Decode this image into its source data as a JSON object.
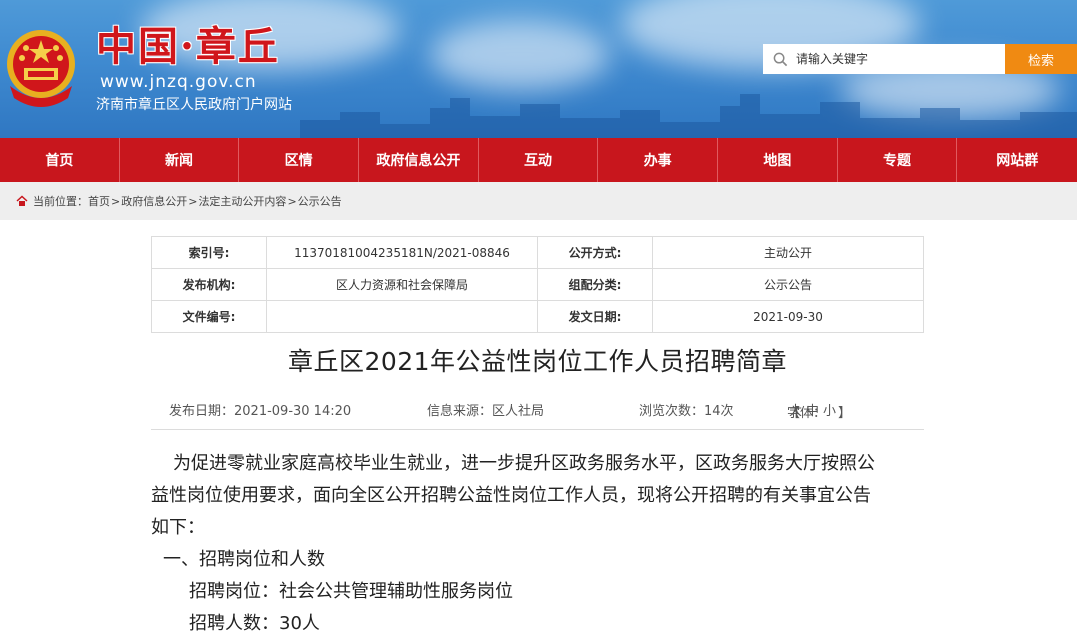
{
  "header": {
    "site_logo_text": "中国·章丘",
    "site_url": "www.jnzq.gov.cn",
    "site_subtitle": "济南市章丘区人民政府门户网站",
    "search_placeholder": "请输入关键字",
    "search_button": "检索"
  },
  "nav": {
    "items": [
      "首页",
      "新闻",
      "区情",
      "政府信息公开",
      "互动",
      "办事",
      "地图",
      "专题",
      "网站群"
    ]
  },
  "breadcrumb": {
    "prefix": "当前位置：",
    "items": [
      "首页",
      "政府信息公开",
      "法定主动公开内容",
      "公示公告"
    ],
    "separator": ">"
  },
  "info_table": {
    "index_label": "索引号:",
    "index_value": "11370181004235181N/2021-08846",
    "open_mode_label": "公开方式:",
    "open_mode_value": "主动公开",
    "publisher_label": "发布机构:",
    "publisher_value": "区人力资源和社会保障局",
    "category_label": "组配分类:",
    "category_value": "公示公告",
    "doc_number_label": "文件编号:",
    "doc_number_value": "",
    "issue_date_label": "发文日期:",
    "issue_date_value": "2021-09-30"
  },
  "article": {
    "title": "章丘区2021年公益性岗位工作人员招聘简章",
    "meta": {
      "publish_date": "发布日期：2021-09-30 14:20",
      "source": "信息来源：区人社局",
      "views": "浏览次数：14次",
      "font_label": "字体：",
      "font_open": "【",
      "font_large": "大",
      "font_medium": "中",
      "font_small": "小",
      "font_close": "】"
    },
    "paragraphs": {
      "p1_line1": "为促进零就业家庭高校毕业生就业，进一步提升区政务服务水平，区政务服务大厅按照公",
      "p1_line2": "益性岗位使用要求，面向全区公开招聘公益性岗位工作人员，现将公开招聘的有关事宜公告",
      "p1_line3": "如下：",
      "section1": "一、招聘岗位和人数",
      "post": "招聘岗位：社会公共管理辅助性服务岗位",
      "count": "招聘人数：30人"
    }
  },
  "colors": {
    "nav_red": "#c8161d",
    "search_orange": "#f08a12",
    "banner_blue": "#3f8ad0"
  }
}
